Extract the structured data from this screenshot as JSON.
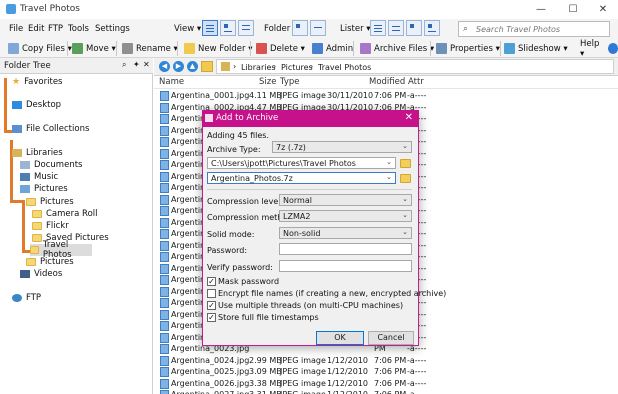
{
  "window": {
    "title": "Travel Photos",
    "btn_min": "—",
    "btn_max": "☐",
    "btn_close": "✕"
  },
  "menu": {
    "file": "File",
    "edit": "Edit",
    "ftp": "FTP",
    "tools": "Tools",
    "settings": "Settings",
    "view": "View ▾",
    "folder": "Folder ▾",
    "lister": "Lister ▾",
    "help": "Help ▾"
  },
  "search": {
    "placeholder": "Search Travel Photos"
  },
  "toolbar": {
    "copy_files": "Copy Files ▾",
    "move": "Move ▾",
    "rename": "Rename ▾",
    "new_folder": "New Folder ▾",
    "delete": "Delete ▾",
    "admin": "Admin",
    "archive_files": "Archive Files ▾",
    "properties": "Properties ▾",
    "slideshow": "Slideshow ▾",
    "help": "Help ▾"
  },
  "tree": {
    "header": "Folder Tree",
    "favorites": "Favorites",
    "desktop": "Desktop",
    "collections": "File Collections",
    "libraries": "Libraries",
    "documents": "Documents",
    "music": "Music",
    "pictures": "Pictures",
    "pictures_sub": "Pictures",
    "camera_roll": "Camera Roll",
    "flickr": "Flickr",
    "saved_pictures": "Saved Pictures",
    "travel_photos": "Travel Photos",
    "pictures_public": "Pictures",
    "videos": "Videos",
    "ftp": "FTP"
  },
  "breadcrumb": {
    "libraries": "Libraries",
    "pictures": "Pictures",
    "travel_photos": "Travel Photos"
  },
  "columns": {
    "name": "Name",
    "size": "Size",
    "type": "Type",
    "modified": "Modified",
    "attr": "Attr"
  },
  "files": [
    {
      "name": "Argentina_0001.jpg",
      "size": "4.11 MB",
      "type": "JPEG image",
      "date": "30/11/2010",
      "time": "7:06 PM",
      "attr": "-a----"
    },
    {
      "name": "Argentina_0002.jpg",
      "size": "4.47 MB",
      "type": "JPEG image",
      "date": "30/11/2010",
      "time": "7:06 PM",
      "attr": "-a----"
    },
    {
      "name": "Argentina_0003.jpg",
      "size": "",
      "type": "",
      "date": "",
      "time": "PM",
      "attr": "-a----"
    },
    {
      "name": "Argentina_0004.jpg",
      "size": "",
      "type": "",
      "date": "",
      "time": "PM",
      "attr": "-a----"
    },
    {
      "name": "Argentina_0005.jpg",
      "size": "",
      "type": "",
      "date": "",
      "time": "PM",
      "attr": "-a----"
    },
    {
      "name": "Argentina_0006.jpg",
      "size": "",
      "type": "",
      "date": "",
      "time": "PM",
      "attr": "-a----"
    },
    {
      "name": "Argentina_0007.jpg",
      "size": "",
      "type": "",
      "date": "",
      "time": "PM",
      "attr": "-a----"
    },
    {
      "name": "Argentina_0008.jpg",
      "size": "",
      "type": "",
      "date": "",
      "time": "PM",
      "attr": "-a----"
    },
    {
      "name": "Argentina_0009.jpg",
      "size": "",
      "type": "",
      "date": "",
      "time": "PM",
      "attr": "-a----"
    },
    {
      "name": "Argentina_0010.jpg",
      "size": "",
      "type": "",
      "date": "",
      "time": "PM",
      "attr": "-a----"
    },
    {
      "name": "Argentina_0011.jpg",
      "size": "",
      "type": "",
      "date": "",
      "time": "PM",
      "attr": "-a----"
    },
    {
      "name": "Argentina_0012.jpg",
      "size": "",
      "type": "",
      "date": "",
      "time": "PM",
      "attr": "-a----"
    },
    {
      "name": "Argentina_0013.jpg",
      "size": "",
      "type": "",
      "date": "",
      "time": "PM",
      "attr": "-a----"
    },
    {
      "name": "Argentina_0014.jpg",
      "size": "",
      "type": "",
      "date": "",
      "time": "PM",
      "attr": "-a----"
    },
    {
      "name": "Argentina_0015.jpg",
      "size": "",
      "type": "",
      "date": "",
      "time": "PM",
      "attr": "-a----"
    },
    {
      "name": "Argentina_0016.jpg",
      "size": "",
      "type": "",
      "date": "",
      "time": "PM",
      "attr": "-a----"
    },
    {
      "name": "Argentina_0017.jpg",
      "size": "",
      "type": "",
      "date": "",
      "time": "PM",
      "attr": "-a----"
    },
    {
      "name": "Argentina_0018.jpg",
      "size": "",
      "type": "",
      "date": "",
      "time": "PM",
      "attr": "-a----"
    },
    {
      "name": "Argentina_0019.jpg",
      "size": "",
      "type": "",
      "date": "",
      "time": "PM",
      "attr": "-a----"
    },
    {
      "name": "Argentina_0020.jpg",
      "size": "",
      "type": "",
      "date": "",
      "time": "PM",
      "attr": "-a----"
    },
    {
      "name": "Argentina_0021.jpg",
      "size": "",
      "type": "",
      "date": "",
      "time": "PM",
      "attr": "-a----"
    },
    {
      "name": "Argentina_0022.jpg",
      "size": "",
      "type": "",
      "date": "",
      "time": "PM",
      "attr": "-a----"
    },
    {
      "name": "Argentina_0023.jpg",
      "size": "",
      "type": "",
      "date": "",
      "time": "PM",
      "attr": "-a----"
    },
    {
      "name": "Argentina_0024.jpg",
      "size": "2.99 MB",
      "type": "JPEG image",
      "date": "1/12/2010",
      "time": "7:06 PM",
      "attr": "-a----"
    },
    {
      "name": "Argentina_0025.jpg",
      "size": "3.09 MB",
      "type": "JPEG image",
      "date": "1/12/2010",
      "time": "7:06 PM",
      "attr": "-a----"
    },
    {
      "name": "Argentina_0026.jpg",
      "size": "3.38 MB",
      "type": "JPEG image",
      "date": "1/12/2010",
      "time": "7:06 PM",
      "attr": "-a----"
    },
    {
      "name": "Argentina_0027.jpg",
      "size": "3.31 MB",
      "type": "JPEG image",
      "date": "1/12/2010",
      "time": "7:06 PM",
      "attr": "-a----"
    }
  ],
  "dialog": {
    "title": "Add to Archive",
    "adding": "Adding 45 files.",
    "archive_type_label": "Archive Type:",
    "archive_type": "7z (.7z)",
    "path": "C:\\Users\\jpott\\Pictures\\Travel Photos",
    "filename": "Argentina_Photos.7z",
    "compression_level_label": "Compression level:",
    "compression_level": "Normal",
    "compression_method_label": "Compression method:",
    "compression_method": "LZMA2",
    "solid_mode_label": "Solid mode:",
    "solid_mode": "Non-solid",
    "password_label": "Password:",
    "verify_label": "Verify password:",
    "mask_password": "Mask password",
    "encrypt_names": "Encrypt file names (if creating a new, encrypted archive)",
    "multithread": "Use multiple threads (on multi-CPU machines)",
    "timestamps": "Store full file timestamps",
    "ok": "OK",
    "cancel": "Cancel",
    "check": "✓"
  }
}
